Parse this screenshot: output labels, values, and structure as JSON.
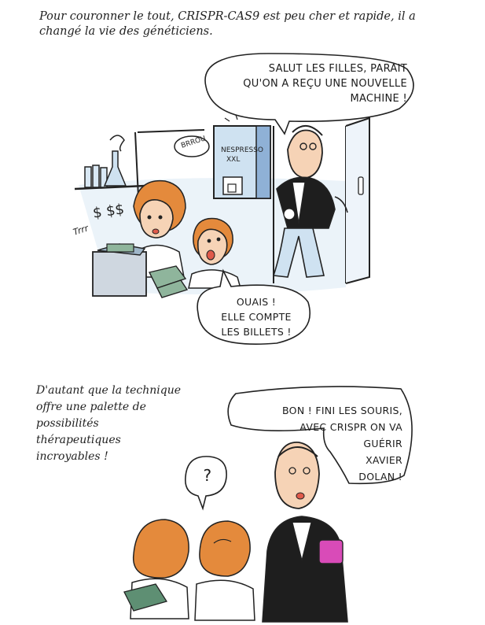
{
  "panel_top": {
    "caption": "Pour couronner le tout, CRISPR-CAS9 est peu cher et rapide, il a\nchangé la vie des généticiens.",
    "bubble_man": "SALUT LES FILLES, PARAIT\nQU'ON A REÇU UNE NOUVELLE\nMACHINE !",
    "bubble_women": "OUAIS !\nELLE COMPTE\nLES BILLETS !",
    "sfx_machine": "BRROU",
    "nespresso_brand": "NESPRESSO",
    "nespresso_size": "XXL",
    "sfx_counter": "Trrr",
    "dollars": "$ $$"
  },
  "panel_bottom": {
    "caption": "D'autant que la technique\noffre une palette de\npossibilités\nthérapeutiques\nincroyables !",
    "bubble_man": "BON ! FINI LES SOURIS,\nAVEC CRISPR ON VA\nGUÉRIR\nXAVIER\nDOLAN !",
    "thought": "?"
  },
  "colors": {
    "ink": "#1b1b1b",
    "hair_orange": "#e48a3c",
    "skin": "#f6d3b6",
    "wall_blue": "#cfe2f1",
    "pink_mug": "#d94bb8",
    "money_green": "#5e8f73",
    "suit_black": "#1e1e1e"
  }
}
